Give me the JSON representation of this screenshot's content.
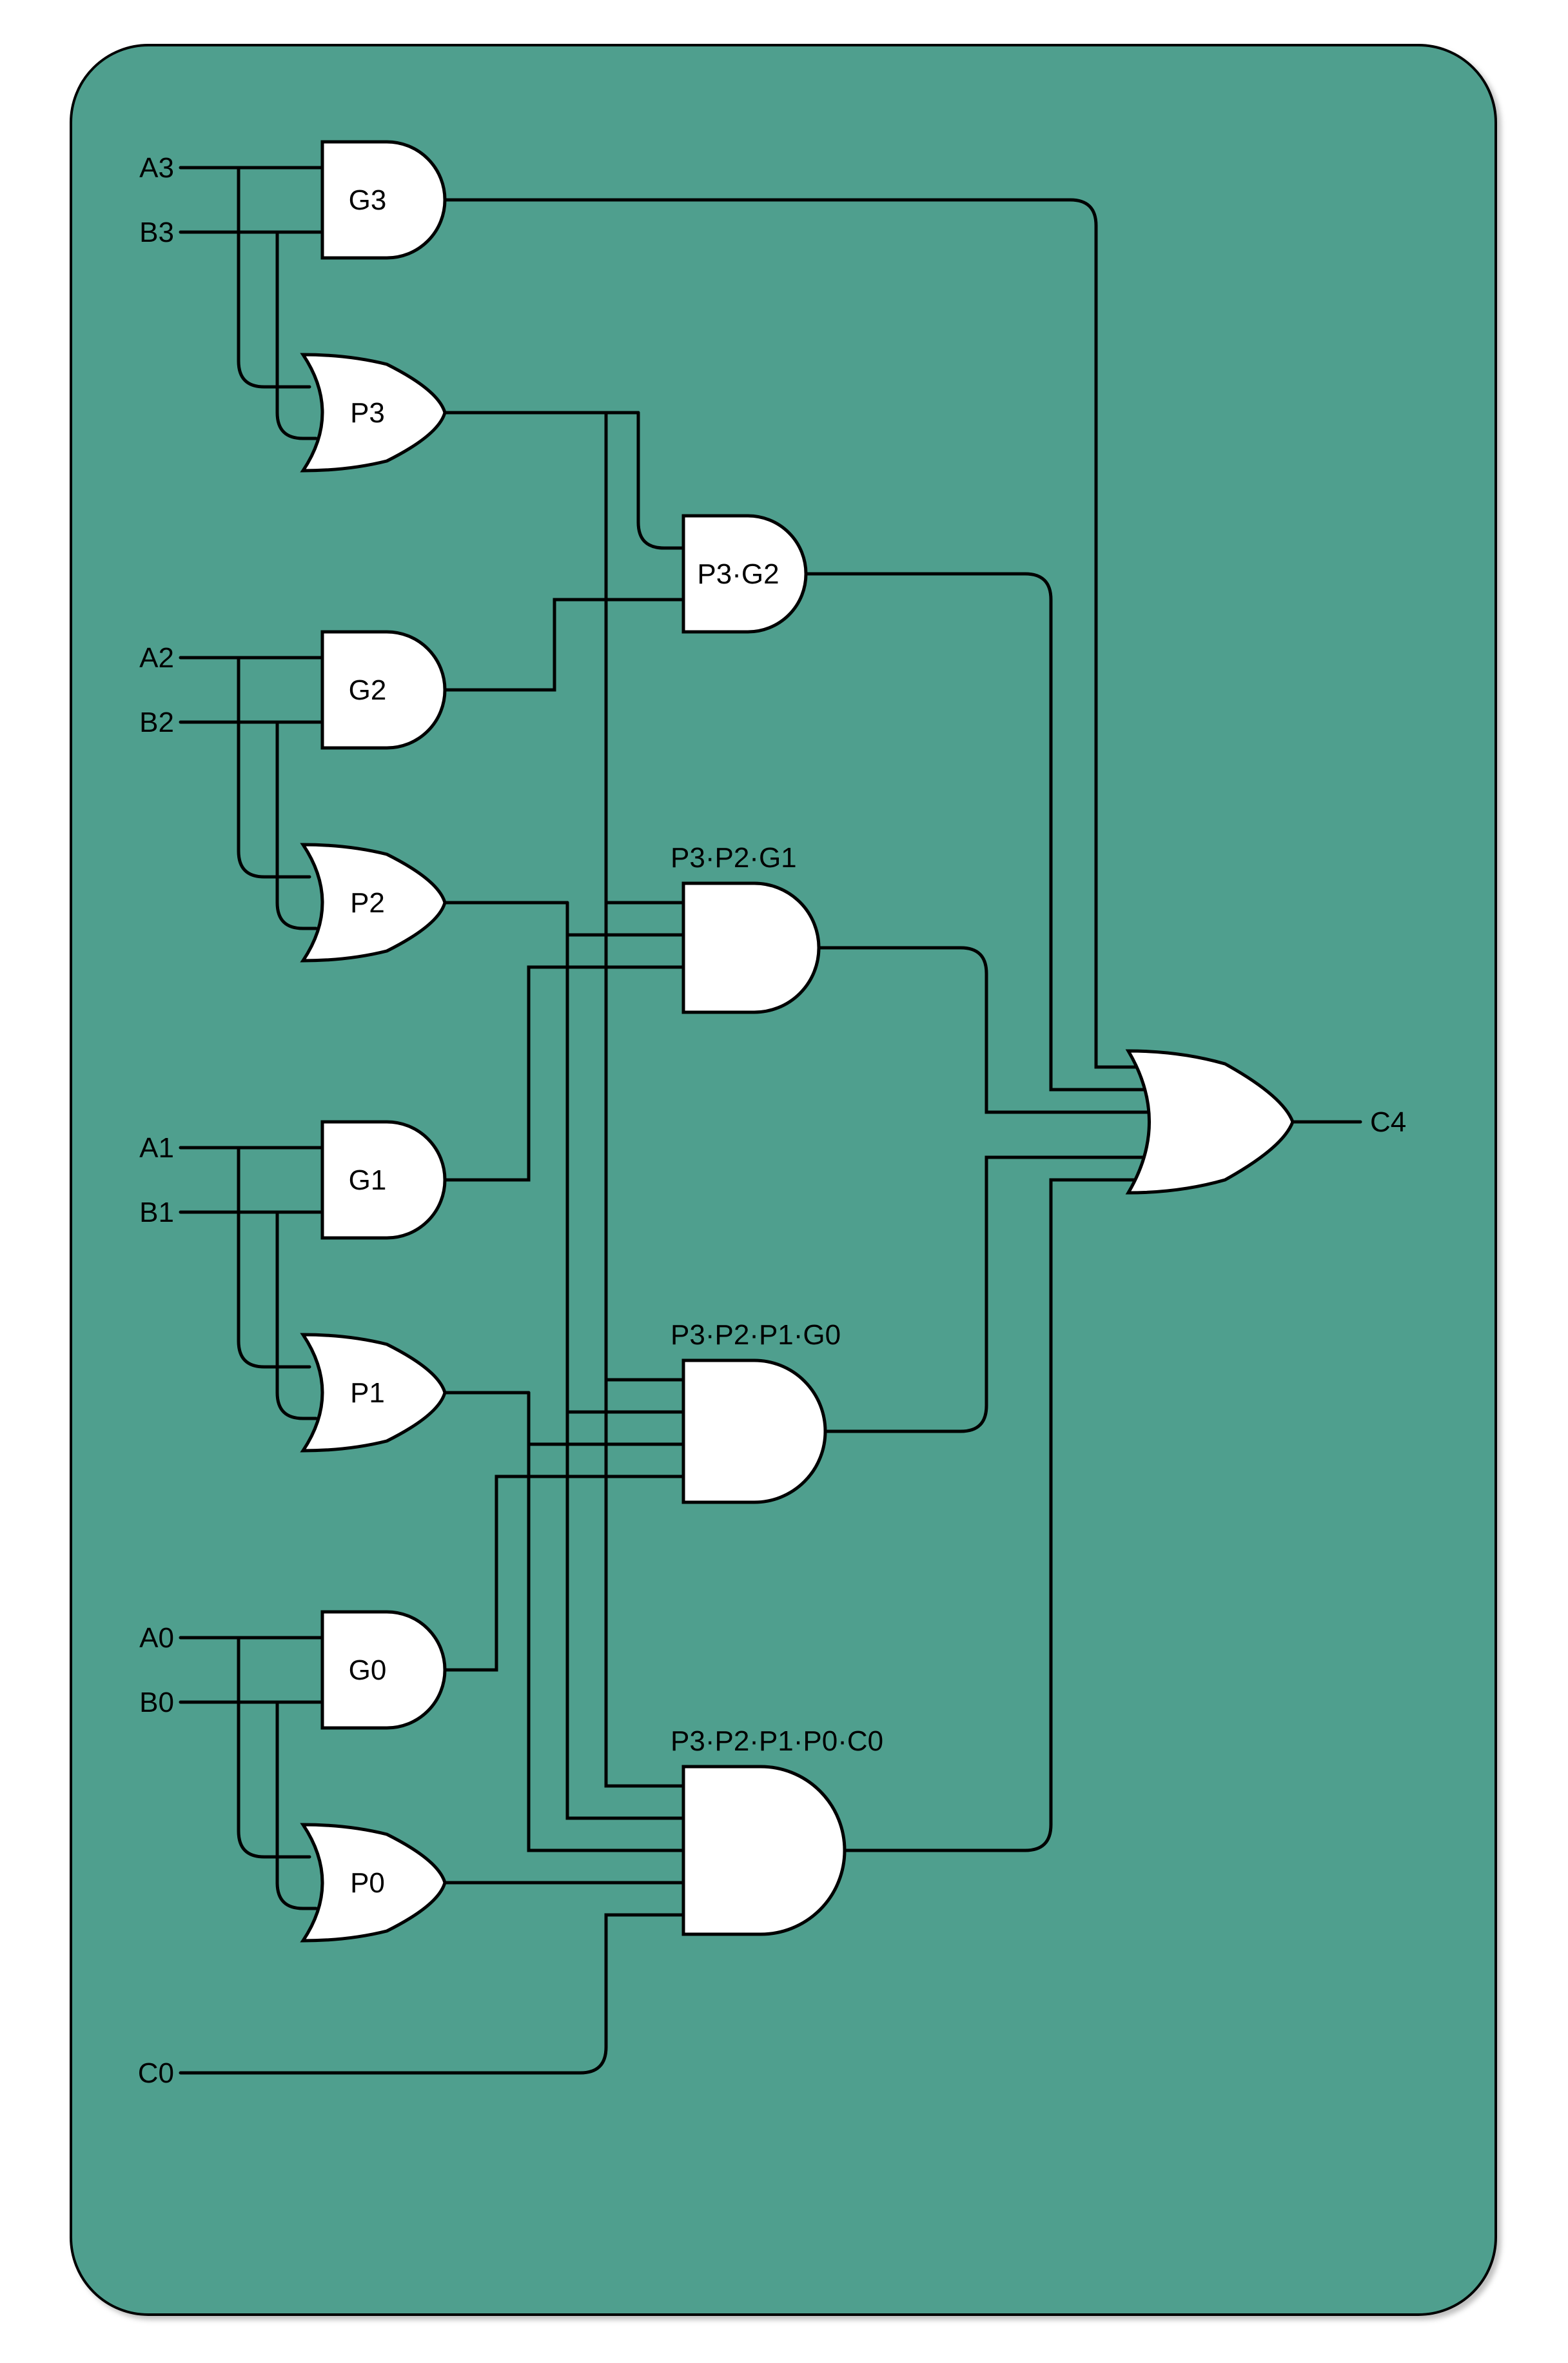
{
  "diagram": {
    "type": "logic-circuit",
    "description": "4-bit carry-lookahead logic generating carry-out C4",
    "inputs": [
      "A3",
      "B3",
      "A2",
      "B2",
      "A1",
      "B1",
      "A0",
      "B0",
      "C0"
    ],
    "output": "C4",
    "generate_gates": {
      "G3": {
        "type": "AND",
        "inputs": [
          "A3",
          "B3"
        ]
      },
      "G2": {
        "type": "AND",
        "inputs": [
          "A2",
          "B2"
        ]
      },
      "G1": {
        "type": "AND",
        "inputs": [
          "A1",
          "B1"
        ]
      },
      "G0": {
        "type": "AND",
        "inputs": [
          "A0",
          "B0"
        ]
      }
    },
    "propagate_gates": {
      "P3": {
        "type": "OR",
        "inputs": [
          "A3",
          "B3"
        ]
      },
      "P2": {
        "type": "OR",
        "inputs": [
          "A2",
          "B2"
        ]
      },
      "P1": {
        "type": "OR",
        "inputs": [
          "A1",
          "B1"
        ]
      },
      "P0": {
        "type": "OR",
        "inputs": [
          "A0",
          "B0"
        ]
      }
    },
    "product_gates": [
      {
        "label": "P3·G2",
        "type": "AND",
        "inputs": [
          "P3",
          "G2"
        ]
      },
      {
        "label": "P3·P2·G1",
        "type": "AND",
        "inputs": [
          "P3",
          "P2",
          "G1"
        ]
      },
      {
        "label": "P3·P2·P1·G0",
        "type": "AND",
        "inputs": [
          "P3",
          "P2",
          "P1",
          "G0"
        ]
      },
      {
        "label": "P3·P2·P1·P0·C0",
        "type": "AND",
        "inputs": [
          "P3",
          "P2",
          "P1",
          "P0",
          "C0"
        ]
      }
    ],
    "final_or": {
      "type": "OR",
      "inputs": [
        "G3",
        "P3·G2",
        "P3·P2·G1",
        "P3·P2·P1·G0",
        "P3·P2·P1·P0·C0"
      ],
      "output": "C4"
    }
  },
  "labels": {
    "A3": "A3",
    "B3": "B3",
    "A2": "A2",
    "B2": "B2",
    "A1": "A1",
    "B1": "B1",
    "A0": "A0",
    "B0": "B0",
    "C0": "C0",
    "C4": "C4",
    "G3": "G3",
    "G2": "G2",
    "G1": "G1",
    "G0": "G0",
    "P3": "P3",
    "P2": "P2",
    "P1": "P1",
    "P0": "P0",
    "T1": "P3·G2",
    "T2": "P3·P2·G1",
    "T3": "P3·P2·P1·G0",
    "T4": "P3·P2·P1·P0·C0"
  }
}
